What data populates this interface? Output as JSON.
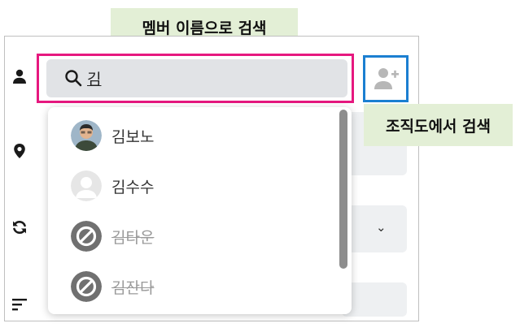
{
  "callouts": {
    "name_search": "멤버 이름으로 검색",
    "org_search": "조직도에서 검색"
  },
  "search": {
    "value": "김",
    "icon": "search-icon"
  },
  "org_button": {
    "icon": "add-user-icon"
  },
  "sidebar": {
    "icons": [
      "person-icon",
      "location-pin-icon",
      "sync-icon",
      "sort-lines-icon"
    ]
  },
  "dropdown": {
    "items": [
      {
        "label": "김보노",
        "avatar": "photo",
        "disabled": false
      },
      {
        "label": "김수수",
        "avatar": "placeholder",
        "disabled": false
      },
      {
        "label": "김타운",
        "avatar": "blocked",
        "disabled": true
      },
      {
        "label": "김잔다",
        "avatar": "blocked",
        "disabled": true
      }
    ]
  },
  "select": {
    "chevron": "⌄"
  },
  "colors": {
    "highlight_pink": "#e6187f",
    "highlight_blue": "#1b7fd1",
    "callout_bg": "#e3efd6",
    "search_bg": "#e1e3e6"
  }
}
